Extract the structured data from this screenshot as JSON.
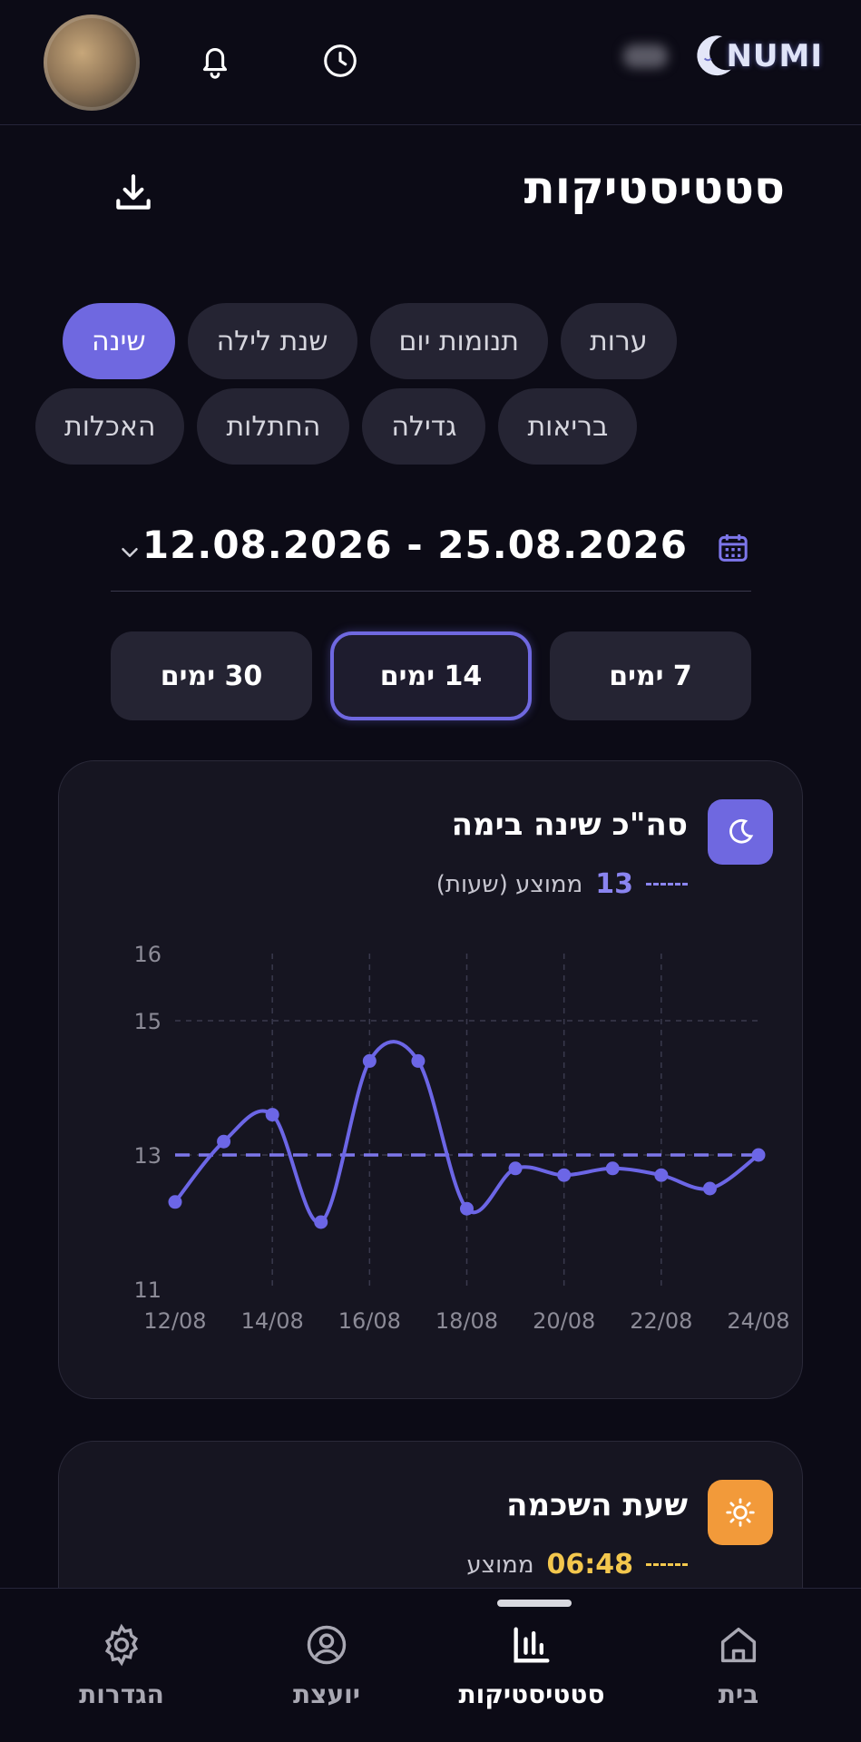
{
  "header": {
    "logo_text": "NUMI",
    "icons": [
      "avatar",
      "bell-icon",
      "clock-icon",
      "moon-logo-icon"
    ]
  },
  "page": {
    "title": "סטטיסטיקות",
    "download_icon": "download-icon"
  },
  "categories": {
    "row1": [
      {
        "label": "שינה",
        "active": true
      },
      {
        "label": "שנת לילה",
        "active": false
      },
      {
        "label": "תנומות יום",
        "active": false
      },
      {
        "label": "ערות",
        "active": false
      }
    ],
    "row2": [
      {
        "label": "האכלות",
        "active": false
      },
      {
        "label": "החתלות",
        "active": false
      },
      {
        "label": "גדילה",
        "active": false
      },
      {
        "label": "בריאות",
        "active": false
      }
    ]
  },
  "date_range": {
    "text": "12.08.2026 - 25.08.2026",
    "calendar_icon": "calendar-icon",
    "chevron_icon": "chevron-down-icon"
  },
  "range_options": [
    {
      "label": "7 ימים",
      "active": false
    },
    {
      "label": "14 ימים",
      "active": true
    },
    {
      "label": "30 ימים",
      "active": false
    }
  ],
  "sleep_card": {
    "title": "סה\"כ שינה בימה",
    "avg_label": "ממוצע (שעות)",
    "avg_value": "13",
    "icon": "moon-icon",
    "accent": "#6f68e0"
  },
  "chart_data": {
    "type": "line",
    "title": "סה\"כ שינה בימה",
    "x": [
      "12/08",
      "13/08",
      "14/08",
      "15/08",
      "16/08",
      "17/08",
      "18/08",
      "19/08",
      "20/08",
      "21/08",
      "22/08",
      "23/08",
      "24/08"
    ],
    "x_tick_labels": [
      "12/08",
      "14/08",
      "16/08",
      "18/08",
      "20/08",
      "22/08",
      "24/08"
    ],
    "series": [
      {
        "values": [
          12.3,
          13.2,
          13.6,
          12.0,
          14.4,
          14.4,
          12.2,
          12.8,
          12.7,
          12.8,
          12.7,
          12.5,
          13.0
        ]
      }
    ],
    "average": 13,
    "y_ticks": [
      11,
      13,
      15,
      16
    ],
    "ylim": [
      11,
      16
    ],
    "grid": true
  },
  "wake_card": {
    "title": "שעת השכמה",
    "avg_label": "ממוצע",
    "avg_value": "06:48",
    "icon": "sun-icon",
    "accent": "#f29a3a",
    "value_color": "#f3c74d"
  },
  "nav": {
    "items": [
      {
        "label": "בית",
        "icon": "home-icon",
        "active": false
      },
      {
        "label": "סטטיסטיקות",
        "icon": "stats-icon",
        "active": true
      },
      {
        "label": "יועצת",
        "icon": "advisor-icon",
        "active": false
      },
      {
        "label": "הגדרות",
        "icon": "settings-icon",
        "active": false
      }
    ]
  }
}
